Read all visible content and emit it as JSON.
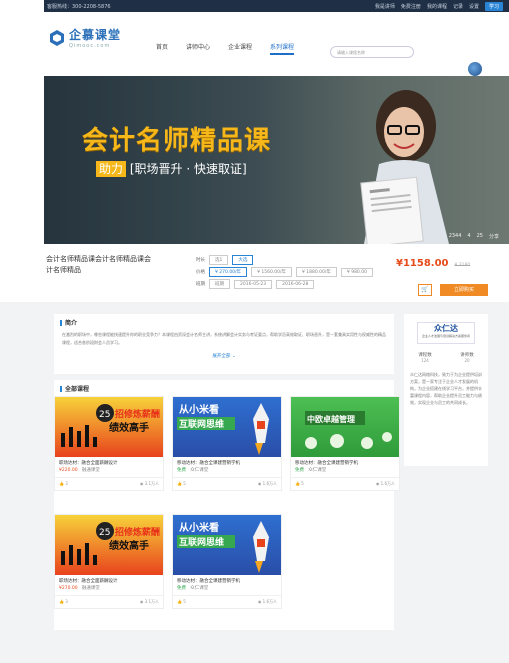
{
  "topbar": {
    "hotline": "客服热线：300-2208-5876",
    "links": [
      "我是讲师",
      "免费注册",
      "我的课程",
      "记录",
      "设置"
    ],
    "button": "学习"
  },
  "header": {
    "logo_cn": "企慕课堂",
    "logo_en": "Qimooc.com",
    "nav": [
      "首页",
      "讲师中心",
      "企业课程",
      "系列课程"
    ],
    "active_nav_index": 3,
    "search_placeholder": "请输入课程名称"
  },
  "banner": {
    "title": "会计名师精品课",
    "subtitle_prefix": "助力",
    "subtitle_highlight": "[职场晋升 · 快速取证]",
    "stats": [
      "2344",
      "4",
      "25",
      "分享"
    ]
  },
  "course": {
    "name": "会计名师精品课会计名师精品课会计名师精品",
    "option_rows": [
      {
        "label": "时长",
        "chips": [
          "选1",
          "大选"
        ],
        "selected": 1
      },
      {
        "label": "价格",
        "chips": [
          "¥ 270.00/年",
          "¥ 1560.00/年",
          "¥ 1880.00/年",
          "¥ 980.00"
        ],
        "selected": 0
      },
      {
        "label": "班期",
        "chips": [
          "班期",
          "2016-05-23",
          "2016-06-28"
        ],
        "selected": -1
      }
    ],
    "price": "¥1158.00",
    "price_old": "¥ 3180",
    "cart_icon": "cart-icon",
    "buy_label": "立即购买"
  },
  "intro": {
    "title": "简介",
    "text": "在激烈的职场中，哪些课程能快速提升你的职业竞争力？本课程由资深会计名师主讲，系统讲解会计实务与考证要点，帮助学员高效取证、职场晋升，是一套兼具实用性与权威性的精品课程，适合各阶段财会人员学习。",
    "more": "展开全部"
  },
  "courses": {
    "title": "全部课程",
    "cards": [
      {
        "theme": "red",
        "banner_num": "25",
        "banner_line1": "招修炼薪酬",
        "banner_line2": "绩效高手",
        "name": "职场达材：融合全面薪酬设计",
        "price": "¥220.00",
        "org": "融通课堂",
        "likes": "3",
        "views": "3.1万人",
        "free": false
      },
      {
        "theme": "blue",
        "banner_line1": "从小米看",
        "banner_line2": "互联网思维",
        "name": "移动达材：融合全课建营销学机",
        "price": "免费",
        "org": "众仁课堂",
        "likes": "5",
        "views": "1.6万人",
        "free": true
      },
      {
        "theme": "green",
        "banner_line1": "中欧卓越管理",
        "name": "移动达材：融合全课建营销学机",
        "price": "免费",
        "org": "众仁课堂",
        "likes": "5",
        "views": "1.6万人",
        "free": true
      },
      {
        "theme": "red",
        "banner_num": "25",
        "banner_line1": "招修炼薪酬",
        "banner_line2": "绩效高手",
        "name": "职场达材：融合全面薪酬设计",
        "price": "¥270.00",
        "org": "融通课堂",
        "likes": "3",
        "views": "3.1万人",
        "free": false
      },
      {
        "theme": "blue",
        "banner_line1": "从小米看",
        "banner_line2": "互联网思维",
        "name": "移动达材：融合全课建营销学机",
        "price": "免费",
        "org": "众仁课堂",
        "likes": "5",
        "views": "1.6万人",
        "free": true
      }
    ]
  },
  "org": {
    "name": "众仁达",
    "tagline": "企业人才发展与培训解决方案服务商",
    "stats": [
      {
        "label": "课程数",
        "value": "124"
      },
      {
        "label": "讲师数",
        "value": "20"
      }
    ],
    "desc": "众仁达网络科技，致力于为企业提供培训方案，是一家专注于企业人才发展的机构，为企业搭建在线学习平台，并提供丰富课程内容，帮助企业提升员工能力与绩效，实现企业与员工的共同成长。"
  },
  "colors": {
    "accent": "#2a84d6",
    "price": "#e64a19",
    "buy": "#f08a24",
    "banner_title": "#f5b719",
    "topbar": "#1f2f45"
  }
}
